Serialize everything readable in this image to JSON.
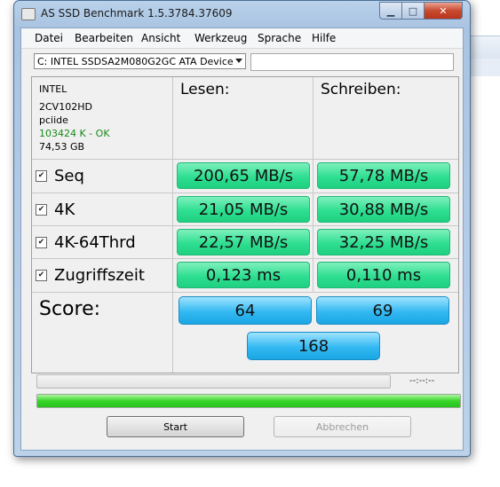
{
  "window": {
    "title": "AS SSD Benchmark 1.5.3784.37609"
  },
  "menu": [
    "Datei",
    "Bearbeiten",
    "Ansicht",
    "Werkzeug",
    "Sprache",
    "Hilfe"
  ],
  "drive": {
    "selected": "C: INTEL SSDSA2M080G2GC ATA Device",
    "search_value": ""
  },
  "info": {
    "vendor": "INTEL",
    "firmware": "2CV102HD",
    "driver": "pciide",
    "alignment": "103424 K - OK",
    "alignment_color": "#1a8a1a",
    "size": "74,53 GB"
  },
  "headers": {
    "read": "Lesen:",
    "write": "Schreiben:"
  },
  "tests": [
    {
      "label": "Seq",
      "checked": true,
      "read": "200,65 MB/s",
      "write": "57,78 MB/s"
    },
    {
      "label": "4K",
      "checked": true,
      "read": "21,05 MB/s",
      "write": "30,88 MB/s"
    },
    {
      "label": "4K-64Thrd",
      "checked": true,
      "read": "22,57 MB/s",
      "write": "32,25 MB/s"
    },
    {
      "label": "Zugriffszeit",
      "checked": true,
      "read": "0,123 ms",
      "write": "0,110 ms"
    }
  ],
  "score": {
    "label": "Score:",
    "read": "64",
    "write": "69",
    "total": "168"
  },
  "progress": {
    "time": "--:--:--",
    "main_fraction": 1.0,
    "top_fraction": 0.0
  },
  "buttons": {
    "start": "Start",
    "cancel": "Abbrechen"
  },
  "colors": {
    "result_green": "#2fdf91",
    "score_blue": "#33b9f2",
    "progress_green": "#37d62a"
  }
}
